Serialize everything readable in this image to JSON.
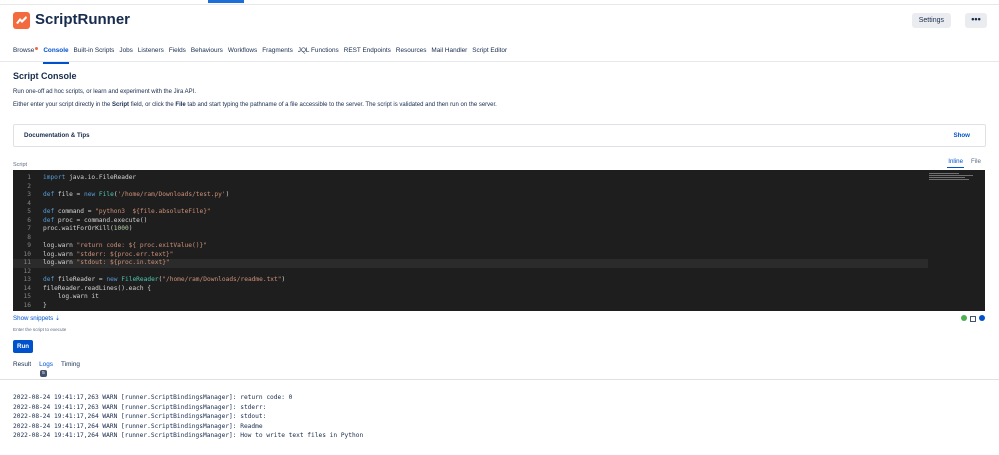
{
  "app": {
    "title": "ScriptRunner",
    "brand_color": "#f26a3d"
  },
  "header": {
    "settings_label": "Settings",
    "more_label": "•••"
  },
  "nav": {
    "items": [
      "Browse",
      "Console",
      "Built-in Scripts",
      "Jobs",
      "Listeners",
      "Fields",
      "Behaviours",
      "Workflows",
      "Fragments",
      "JQL Functions",
      "REST Endpoints",
      "Resources",
      "Mail Handler",
      "Script Editor"
    ],
    "active": "Console"
  },
  "page": {
    "title": "Script Console",
    "desc1": "Run one-off ad hoc scripts, or learn and experiment with the Jira API.",
    "desc2_parts": [
      "Either enter your script directly in the ",
      "Script",
      " field, or click the ",
      "File",
      " tab and start typing the pathname of a file accessible to the server. The script is validated and then run on the server."
    ]
  },
  "docs": {
    "title": "Documentation & Tips",
    "show_label": "Show"
  },
  "script": {
    "label": "Script",
    "tabs": {
      "inline": "Inline",
      "file": "File"
    },
    "line_numbers": [
      "1",
      "2",
      "3",
      "4",
      "5",
      "6",
      "7",
      "8",
      "9",
      "10",
      "11",
      "12",
      "13",
      "14",
      "15",
      "16"
    ],
    "lines": [
      "import java.io.FileReader",
      "",
      "def file = new File('/home/ram/Downloads/test.py')",
      "",
      "def command = \"python3  ${file.absoluteFile}\"",
      "def proc = command.execute()",
      "proc.waitForOrKill(1000)",
      "",
      "log.warn \"return code: ${ proc.exitValue()}\"",
      "log.warn \"stderr: ${proc.err.text}\"",
      "log.warn \"stdout: ${proc.in.text}\"",
      "",
      "def fileReader = new FileReader(\"/home/ram/Downloads/readme.txt\")",
      "fileReader.readLines().each {",
      "    log.warn it",
      "}"
    ],
    "current_line": 11
  },
  "snippets": {
    "label": "Show snippets",
    "hint": "Enter the script to execute"
  },
  "run": {
    "label": "Run"
  },
  "result_tabs": {
    "result": "Result",
    "logs": "Logs",
    "logs_count": "5",
    "timing": "Timing",
    "active": "Logs"
  },
  "logs": [
    "2022-08-24 19:41:17,263 WARN [runner.ScriptBindingsManager]: return code: 0",
    "2022-08-24 19:41:17,263 WARN [runner.ScriptBindingsManager]: stderr:",
    "2022-08-24 19:41:17,264 WARN [runner.ScriptBindingsManager]: stdout:",
    "2022-08-24 19:41:17,264 WARN [runner.ScriptBindingsManager]: Readme",
    "2022-08-24 19:41:17,264 WARN [runner.ScriptBindingsManager]: How to write text files in Python"
  ]
}
